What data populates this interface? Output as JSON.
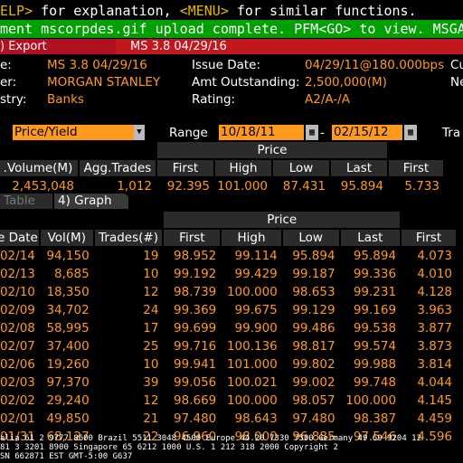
{
  "help_bar": {
    "text_a": "ELP>",
    "text_b": " for explanation, ",
    "text_c": "<MENU>",
    "text_d": " for similar functions."
  },
  "alert": "ment mscorpdes.gif upload complete. PFM<GO> to view. MSGA",
  "toolbar": {
    "export_label": ") Export",
    "security_title": "MS 3.8 04/29/16"
  },
  "info": {
    "rows": [
      {
        "l1": "e:",
        "v1": "MS 3.8 04/29/16",
        "l2": "Issue Date:",
        "v2": "04/29/11@180.000bps",
        "l3": "Cu"
      },
      {
        "l1": "er:",
        "v1": "MORGAN STANLEY",
        "l2": "Amt Outstanding:",
        "v2": "2,500,000(M)",
        "l3": "Ne"
      },
      {
        "l1": "stry:",
        "v1": "Banks",
        "l2": "Rating:",
        "v2": "A2/A-/A",
        "l3": ""
      }
    ]
  },
  "controls": {
    "mode": "Price/Yield",
    "range_label": "Range",
    "start_date": "10/18/11",
    "dash": "-",
    "end_date": "02/15/12",
    "tra_label": "Tra"
  },
  "summary": {
    "group_label": "Price",
    "headers": [
      ".Volume(M)",
      "Agg.Trades",
      "First",
      "High",
      "Low",
      "Last",
      "First"
    ],
    "values": [
      "2,453,048",
      "1,012",
      "92.395",
      "101.000",
      "87.431",
      "95.894",
      "5.733"
    ]
  },
  "tabs": {
    "table": "Table",
    "graph": "4) Graph"
  },
  "trades": {
    "group_label": "Price",
    "headers": [
      "e Date",
      "Vol(M)",
      "Trades(#)",
      "First",
      "High",
      "Low",
      "Last",
      "First"
    ],
    "rows": [
      [
        "02/14",
        "94,150",
        "19",
        "98.952",
        "99.114",
        "95.894",
        "95.894",
        "4.073"
      ],
      [
        "02/13",
        "8,685",
        "10",
        "99.192",
        "99.429",
        "99.187",
        "99.336",
        "4.010"
      ],
      [
        "02/10",
        "18,350",
        "12",
        "98.739",
        "100.000",
        "98.653",
        "99.231",
        "4.128"
      ],
      [
        "02/09",
        "34,702",
        "24",
        "99.369",
        "99.675",
        "99.129",
        "99.169",
        "3.963"
      ],
      [
        "02/08",
        "58,995",
        "17",
        "99.699",
        "99.900",
        "99.486",
        "99.538",
        "3.877"
      ],
      [
        "02/07",
        "37,400",
        "25",
        "99.716",
        "100.136",
        "98.817",
        "99.574",
        "3.873"
      ],
      [
        "02/06",
        "19,260",
        "10",
        "99.941",
        "101.000",
        "99.802",
        "99.988",
        "3.814"
      ],
      [
        "02/03",
        "97,370",
        "39",
        "99.056",
        "100.021",
        "99.002",
        "99.748",
        "4.044"
      ],
      [
        "02/02",
        "29,240",
        "12",
        "98.669",
        "100.000",
        "98.057",
        "100.000",
        "4.145"
      ],
      [
        "02/01",
        "49,850",
        "21",
        "97.480",
        "98.643",
        "97.480",
        "98.387",
        "4.459"
      ],
      [
        "01/31",
        "68,127",
        "22",
        "96.960",
        "98.000",
        "96.885",
        "97.546",
        "4.596"
      ]
    ]
  },
  "footer": {
    "line1": "alia 61 2 9777 8600 Brazil 5511 3048 4500 Europe 44 20 7330 7500 Germany 49 69 9204 12",
    "line2": " 81 3 3201 8900          Singapore 65 6212 1000          U.S. 1 212 318 2000          Copyright 2",
    "line3": "                                                        SN 662871 EST  GMT-5:00 G637"
  }
}
